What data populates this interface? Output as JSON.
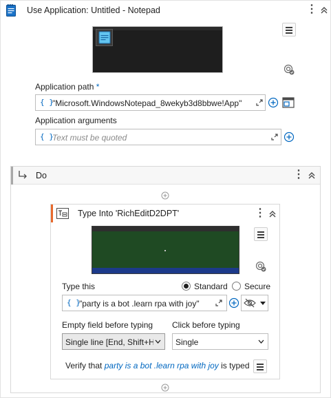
{
  "header": {
    "title": "Use Application: Untitled - Notepad"
  },
  "application_path": {
    "label": "Application path",
    "required_mark": "*",
    "value": "\"Microsoft.WindowsNotepad_8wekyb3d8bbwe!App\""
  },
  "application_arguments": {
    "label": "Application arguments",
    "placeholder": "Text must be quoted"
  },
  "do_panel": {
    "title": "Do"
  },
  "type_into": {
    "title": "Type Into 'RichEditD2DPT'",
    "type_this_label": "Type this",
    "options": [
      "Standard",
      "Secure"
    ],
    "selected_option": "Standard",
    "value": "\"party is a bot .learn rpa with joy\"",
    "empty_field_label": "Empty field before typing",
    "empty_field_value": "Single line [End, Shift+H",
    "click_before_label": "Click before typing",
    "click_before_value": "Single",
    "verify_prefix": "Verify that",
    "verify_text": "party is a bot .learn rpa with joy",
    "verify_suffix": "is typed"
  },
  "colors": {
    "accent_blue": "#0067c0",
    "activity_accent": "#e8692c",
    "screenshot_green": "#1f4a23"
  },
  "curly_glyph": "{ }"
}
